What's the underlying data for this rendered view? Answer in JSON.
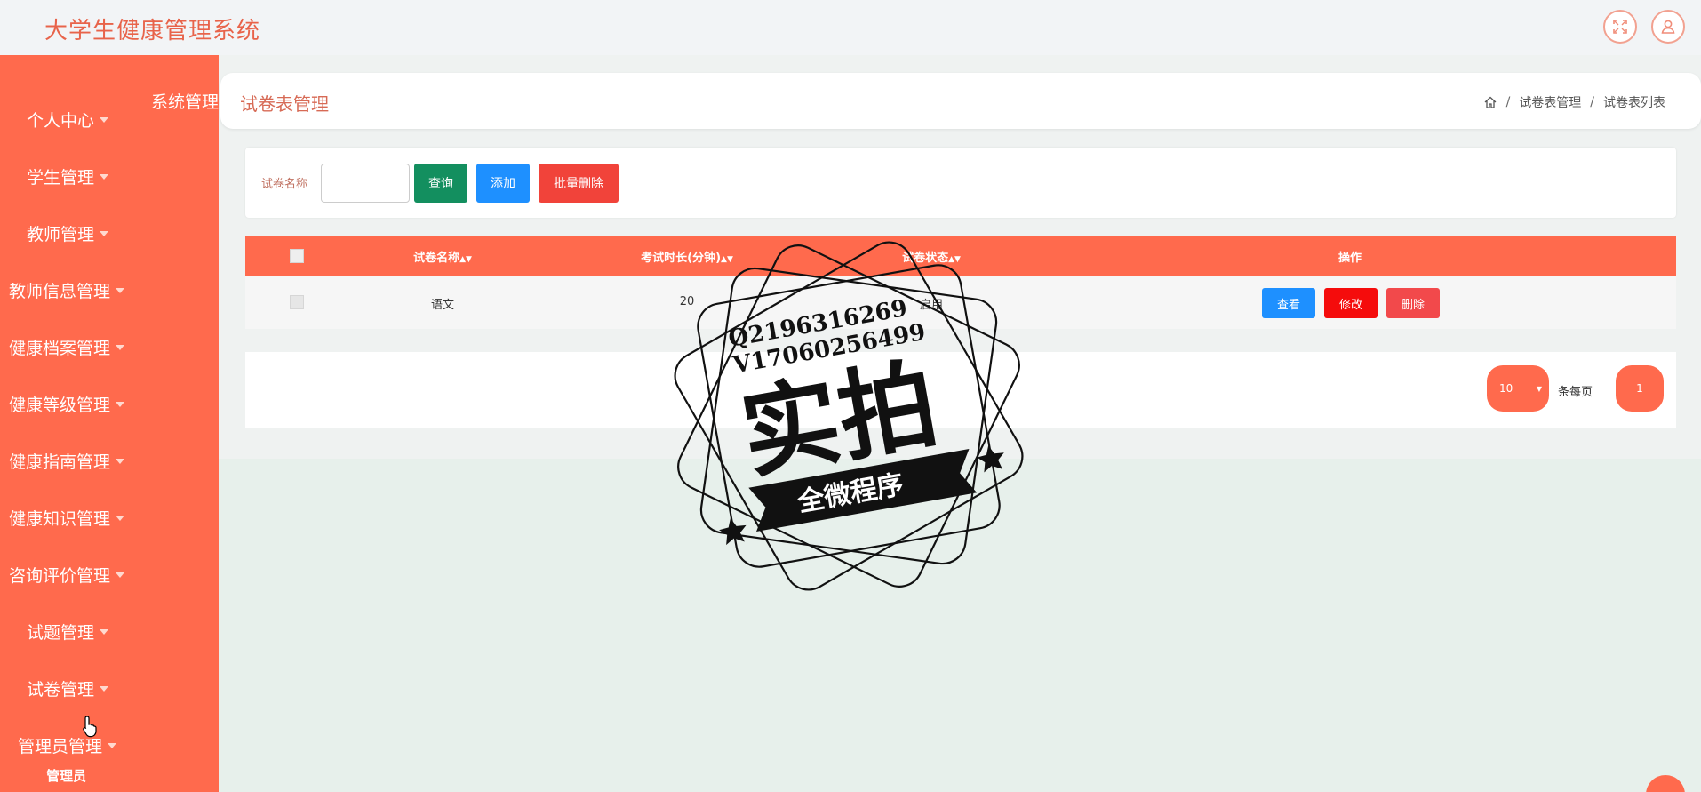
{
  "app": {
    "title": "大学生健康管理系统"
  },
  "sidebar": {
    "items": [
      {
        "label": "个人中心"
      },
      {
        "label": "学生管理"
      },
      {
        "label": "教师管理"
      },
      {
        "label": "教师信息管理"
      },
      {
        "label": "健康档案管理"
      },
      {
        "label": "健康等级管理"
      },
      {
        "label": "健康指南管理"
      },
      {
        "label": "健康知识管理"
      },
      {
        "label": "咨询评价管理"
      },
      {
        "label": "试题管理"
      },
      {
        "label": "试卷管理"
      },
      {
        "label": "管理员管理"
      }
    ],
    "system_menu": "系统管理",
    "sub_item": "管理员"
  },
  "page": {
    "title": "试卷表管理",
    "breadcrumb": [
      "试卷表管理",
      "试卷表列表"
    ]
  },
  "search": {
    "label": "试卷名称",
    "value": "",
    "query_label": "查询",
    "add_label": "添加",
    "batch_delete_label": "批量删除"
  },
  "table": {
    "columns": [
      "试卷名称",
      "考试时长(分钟)",
      "试卷状态",
      "操作"
    ],
    "rows": [
      {
        "name": "语文",
        "duration": "20",
        "status": "启用"
      }
    ],
    "actions": {
      "view": "查看",
      "edit": "修改",
      "delete": "删除"
    }
  },
  "pagination": {
    "page_size": "10",
    "per_page_label": "条每页",
    "current_page": "1"
  },
  "watermark": {
    "lines": [
      "Q2196316269",
      "V17060256499"
    ],
    "main": "实拍",
    "banner": "全微程序"
  },
  "colors": {
    "accent": "#ff6a4d",
    "title": "#e8634a",
    "query": "#138f5f",
    "add": "#1e90ff",
    "batch_delete": "#f1433a",
    "edit": "#f50c0c",
    "delete": "#f2494b"
  }
}
